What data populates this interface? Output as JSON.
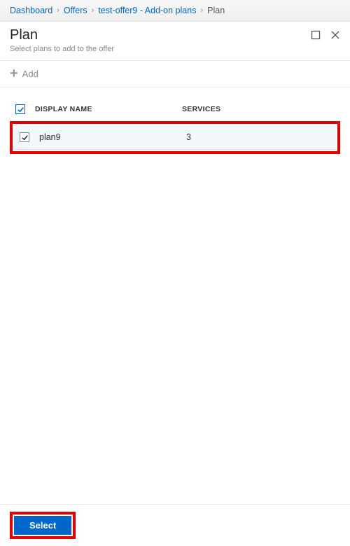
{
  "breadcrumb": {
    "items": [
      {
        "label": "Dashboard",
        "link": true
      },
      {
        "label": "Offers",
        "link": true
      },
      {
        "label": "test-offer9 - Add-on plans",
        "link": true
      },
      {
        "label": "Plan",
        "link": false
      }
    ]
  },
  "header": {
    "title": "Plan",
    "subtitle": "Select plans to add to the offer"
  },
  "toolbar": {
    "add_label": "Add"
  },
  "table": {
    "columns": {
      "display_name": "DISPLAY NAME",
      "services": "SERVICES"
    },
    "header_checked": true,
    "rows": [
      {
        "checked": true,
        "display_name": "plan9",
        "services": "3"
      }
    ]
  },
  "footer": {
    "select_label": "Select"
  }
}
